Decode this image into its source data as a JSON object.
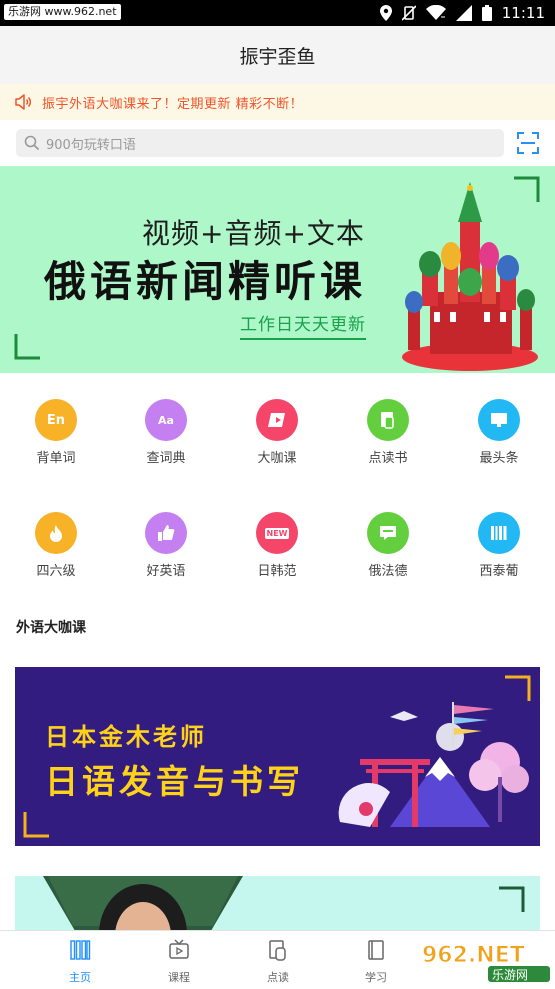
{
  "status_bar": {
    "watermark": "乐游网 www.962.net",
    "time": "11:11"
  },
  "header": {
    "title": "振宇歪鱼"
  },
  "notice": {
    "text": "振宇外语大咖课来了！定期更新 精彩不断！"
  },
  "search": {
    "placeholder": "900句玩转口语"
  },
  "banner1": {
    "line1": "视频+音频+文本",
    "line2": "俄语新闻精听课",
    "line3": "工作日天天更新"
  },
  "grid": [
    {
      "label": "背单词",
      "icon": "en-icon",
      "glyph": "En",
      "color": "#f7b228"
    },
    {
      "label": "查词典",
      "icon": "dictionary-icon",
      "glyph": "Aa",
      "color": "#c47ff0"
    },
    {
      "label": "大咖课",
      "icon": "video-course-icon",
      "glyph": "▶",
      "color": "#f5466a"
    },
    {
      "label": "点读书",
      "icon": "book-icon",
      "glyph": "✋",
      "color": "#63cf3f"
    },
    {
      "label": "最头条",
      "icon": "monitor-icon",
      "glyph": "▬",
      "color": "#22b8f3"
    },
    {
      "label": "四六级",
      "icon": "fire-icon",
      "glyph": "🔥",
      "color": "#f7b228"
    },
    {
      "label": "好英语",
      "icon": "thumbs-up-icon",
      "glyph": "👍",
      "color": "#c47ff0"
    },
    {
      "label": "日韩范",
      "icon": "new-badge-icon",
      "glyph": "NEW",
      "color": "#f5466a"
    },
    {
      "label": "俄法德",
      "icon": "chat-icon",
      "glyph": "▤",
      "color": "#63cf3f"
    },
    {
      "label": "西泰葡",
      "icon": "barcode-icon",
      "glyph": "▥",
      "color": "#22b8f3"
    }
  ],
  "section": {
    "title": "外语大咖课"
  },
  "banner2": {
    "line1": "日本金木老师",
    "line2": "日语发音与书写"
  },
  "bottom_nav": [
    {
      "label": "主页",
      "icon": "home-icon",
      "active": true
    },
    {
      "label": "课程",
      "icon": "tv-icon",
      "active": false
    },
    {
      "label": "点读",
      "icon": "read-icon",
      "active": false
    },
    {
      "label": "学习",
      "icon": "study-icon",
      "active": false
    }
  ],
  "watermark_br": "962.NET 乐游网",
  "colors": {
    "accent": "#1e90ff",
    "notice_text": "#f0552a",
    "banner1_bg": "#aef7c9",
    "banner2_bg": "#331c80",
    "banner2_text": "#ffd21a"
  }
}
